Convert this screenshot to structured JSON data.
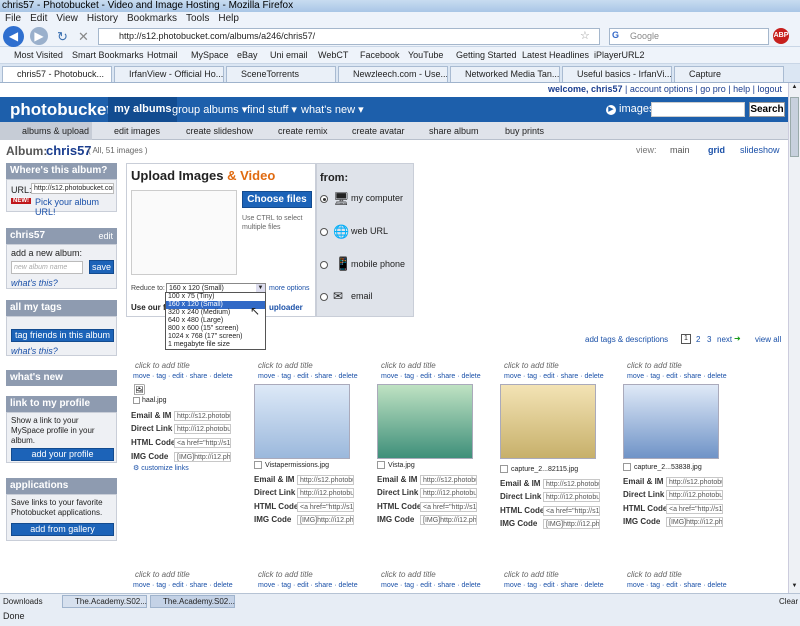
{
  "window": {
    "title": "chris57 - Photobucket - Video and Image Hosting - Mozilla Firefox"
  },
  "menu": [
    "File",
    "Edit",
    "View",
    "History",
    "Bookmarks",
    "Tools",
    "Help"
  ],
  "nav": {
    "url": "http://s12.photobucket.com/albums/a246/chris57/",
    "search_placeholder": "Google"
  },
  "bookmarks": [
    "Most Visited",
    "Smart Bookmarks",
    "Hotmail",
    "MySpace",
    "eBay",
    "Uni email",
    "WebCT",
    "Facebook",
    "YouTube",
    "Getting Started",
    "Latest Headlines",
    "iPlayerURL2"
  ],
  "tabs": [
    "chris57 - Photobuck...",
    "IrfanView - Official Ho...",
    "SceneTorrents",
    "Newzleech.com - Use...",
    "Networked Media Tan...",
    "Useful basics - IrfanVi...",
    "Capture"
  ],
  "pb": {
    "welcome": "welcome, chris57",
    "account": "account options",
    "gopro": "go pro",
    "help": "help",
    "logout": "logout",
    "logo": "photobucket",
    "nav": [
      "my albums",
      "group albums ▾",
      "find stuff ▾",
      "what's new ▾"
    ],
    "images_label": "images",
    "search_btn": "Search",
    "subnav": [
      "albums & upload",
      "edit images",
      "create slideshow",
      "create remix",
      "create avatar",
      "share album",
      "buy prints"
    ],
    "album_label": "Album:",
    "album_name": "chris57",
    "album_count": "( All, 51 images )",
    "view_label": "view:",
    "view_main": "main",
    "view_grid": "grid",
    "view_slideshow": "slideshow",
    "where_title": "Where's this album?",
    "url_label": "URL:",
    "url_value": "http://s12.photobucket.com",
    "new_badge": "NEW!",
    "pick_url": "Pick your album URL!",
    "chris_title": "chris57",
    "edit": "edit",
    "add_album": "add a new album:",
    "album_placeholder": "new album name",
    "save": "save",
    "whats_this": "what's this?",
    "tags_title": "all my tags",
    "tag_friends": "tag friends in this album",
    "whats_this2": "what's this?",
    "whatsnew_title": "what's new",
    "link_title": "link to my profile",
    "link_text": "Show a link to your MySpace profile in your album.",
    "add_profile": "add your profile",
    "apps_title": "applications",
    "apps_text": "Save links to your favorite Photobucket applications.",
    "add_gallery": "add from gallery",
    "upload_title_1": "Upload Images",
    "upload_amp": "&",
    "upload_title_2": "Video",
    "choose_files": "Choose files",
    "ctrl_hint": "Use CTRL to select multiple files",
    "from": "from:",
    "sources": [
      "my computer",
      "web URL",
      "mobile phone",
      "email"
    ],
    "reduce_label": "Reduce to:",
    "reduce_value": "160 x 120 (Small)",
    "more_options": "more options",
    "use_our": "Use our fa",
    "uploader": "uploader",
    "dropdown": [
      "100 x 75 (Tiny)",
      "160 x 120 (Small)",
      "320 x 240 (Medium)",
      "640 x 480 (Large)",
      "800 x 600 (15\" screen)",
      "1024 x 768 (17\" screen)",
      "1 megabyte file size"
    ],
    "add_tags": "add tags & descriptions",
    "pages": [
      "1",
      "2",
      "3"
    ],
    "next": "next",
    "view_all": "view all",
    "click_title": "click to add title",
    "actions": "move · tag · edit · share · delete",
    "lbl_email": "Email & IM",
    "lbl_direct": "Direct Link",
    "lbl_html": "HTML Code",
    "lbl_img": "IMG Code",
    "lbl_email2": "Email & IM",
    "lbl_direct2": "Direct Link",
    "lbl_html2": "HTML Code",
    "lbl_img2": "IMG Code",
    "val_link": "http://s12.photobu",
    "val_link2": "http://i12.photobu",
    "val_html": "<a href=\"http://s12",
    "val_img": "[IMG]http://i12.ph",
    "customize": "customize links",
    "photos": [
      "haal.jpg",
      "Vistapermissions.jpg",
      "Vista.jpg",
      "capture_2...82115.jpg",
      "capture_2...53838.jpg"
    ]
  },
  "status": {
    "downloads": "Downloads",
    "task1": "The.Academy.S02...",
    "task2": "The.Academy.S02...",
    "clear": "Clear",
    "done": "Done"
  }
}
